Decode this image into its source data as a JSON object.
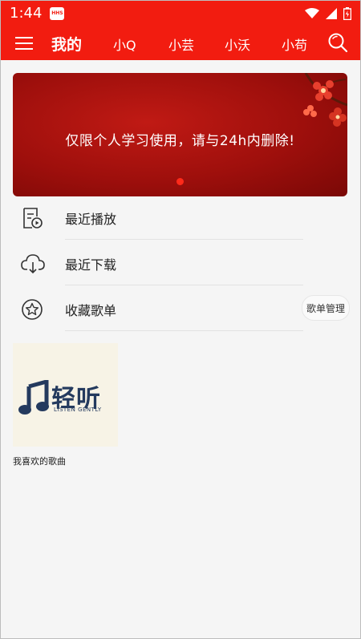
{
  "status_bar": {
    "time": "1:44",
    "app_badge": "HHS",
    "icons": [
      "wifi-icon",
      "signal-icon",
      "battery-icon"
    ]
  },
  "app_bar": {
    "tabs": [
      {
        "label": "我的",
        "active": true
      },
      {
        "label": "小Q",
        "active": false
      },
      {
        "label": "小芸",
        "active": false
      },
      {
        "label": "小沃",
        "active": false
      },
      {
        "label": "小苟",
        "active": false
      }
    ],
    "icons": [
      "menu-icon",
      "search-icon"
    ]
  },
  "banner": {
    "text": "仅限个人学习使用，请与24h内删除!"
  },
  "menu_list": [
    {
      "label": "最近播放",
      "icon": "recent-play-icon"
    },
    {
      "label": "最近下载",
      "icon": "cloud-download-icon"
    },
    {
      "label": "收藏歌单",
      "icon": "star-icon",
      "action_label": "歌单管理"
    }
  ],
  "playlists": [
    {
      "name": "我喜欢的歌曲",
      "cover_logo": "轻听",
      "cover_subtitle": "LISTEN GENTLY"
    }
  ],
  "colors": {
    "primary": "#f21c10",
    "banner_dark": "#9e0f0c",
    "logo_blue": "#243a5e",
    "background": "#f5f5f5"
  }
}
